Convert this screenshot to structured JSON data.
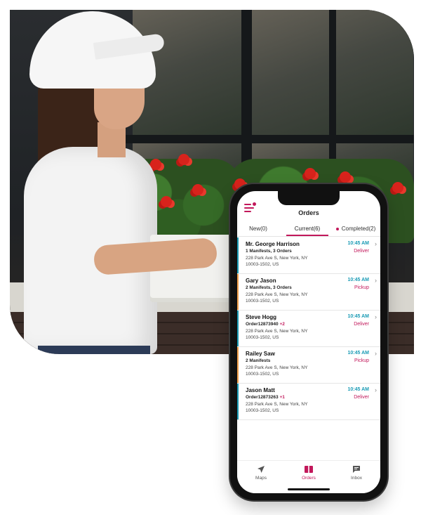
{
  "app": {
    "title": "Orders"
  },
  "tabs": [
    {
      "label": "New(0)"
    },
    {
      "label": "Current(6)"
    },
    {
      "label": "Completed(2)"
    }
  ],
  "orders": [
    {
      "name": "Mr. George Harrison",
      "summary": "1 Manifests, 3 Orders",
      "extra": "",
      "address_line1": "228 Park Ave S, New York, NY",
      "address_line2": "10003-1502, US",
      "time": "10:45 AM",
      "action": "Deliver",
      "accent": "#1a9bb5"
    },
    {
      "name": "Gary Jason",
      "summary": "2 Manifests, 3 Orders",
      "extra": "",
      "address_line1": "228 Park Ave S, New York, NY",
      "address_line2": "10003-1502, US",
      "time": "10:45 AM",
      "action": "Pickup",
      "accent": "#f0a04b"
    },
    {
      "name": "Steve Hogg",
      "summary": "Order12873940",
      "extra": "+2",
      "address_line1": "228 Park Ave S, New York, NY",
      "address_line2": "10003-1502, US",
      "time": "10:45 AM",
      "action": "Deliver",
      "accent": "#1a9bb5"
    },
    {
      "name": "Railey Saw",
      "summary": "2 Manifests",
      "extra": "",
      "address_line1": "228 Park Ave S, New York, NY",
      "address_line2": "10003-1502, US",
      "time": "10:45 AM",
      "action": "Pickup",
      "accent": "#f0a04b"
    },
    {
      "name": "Jason Matt",
      "summary": "Order12873263",
      "extra": "+1",
      "address_line1": "228 Park Ave S, New York, NY",
      "address_line2": "10003-1502, US",
      "time": "10:45 AM",
      "action": "Deliver",
      "accent": "#1a9bb5"
    }
  ],
  "nav": [
    {
      "label": "Maps",
      "icon": "navigation-arrow-icon"
    },
    {
      "label": "Orders",
      "icon": "orders-icon"
    },
    {
      "label": "Inbox",
      "icon": "inbox-icon"
    }
  ],
  "colors": {
    "brand": "#c2185b",
    "time": "#1a9bb5",
    "pickup_accent": "#f0a04b",
    "deliver_accent": "#1a9bb5"
  }
}
